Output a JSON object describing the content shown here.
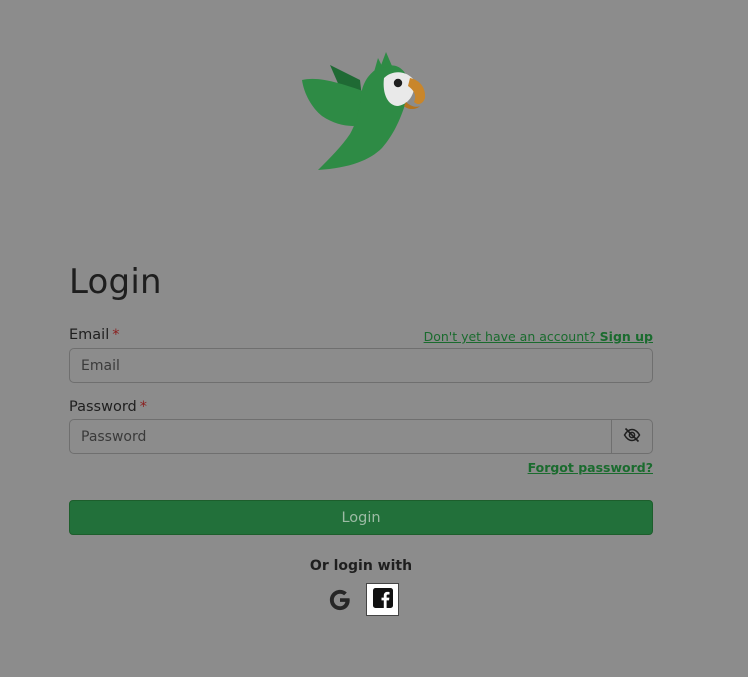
{
  "brand": {
    "logo_icon": "parrot-logo-icon",
    "colors": {
      "parrot_green": "#2e8b45",
      "parrot_dark_green": "#1f6a34",
      "beak_orange": "#c9862b",
      "page_background": "#8c8c8c",
      "accent_green": "#22703a",
      "link_green": "#1a6b2e",
      "required_red": "#8b1d1d"
    }
  },
  "page": {
    "title": "Login"
  },
  "form": {
    "email": {
      "label": "Email",
      "required_mark": "*",
      "placeholder": "Email",
      "value": ""
    },
    "signup_prompt": "Don't yet have an account?",
    "signup_link": "Sign up",
    "password": {
      "label": "Password",
      "required_mark": "*",
      "placeholder": "Password",
      "value": "",
      "toggle_icon": "eye-slash-icon"
    },
    "forgot_password": "Forgot password?",
    "submit_label": "Login"
  },
  "social": {
    "heading": "Or login with",
    "providers": [
      {
        "name": "Google",
        "icon": "google-icon"
      },
      {
        "name": "Facebook",
        "icon": "facebook-icon"
      }
    ]
  }
}
